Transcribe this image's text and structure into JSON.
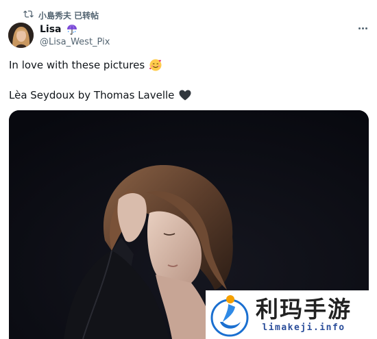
{
  "retweet": {
    "label": "小島秀夫 已转帖",
    "icon": "retweet-icon"
  },
  "author": {
    "display_name": "Lisa",
    "name_emoji": "umbrella-icon",
    "handle": "@Lisa_West_Pix",
    "avatar": "avatar"
  },
  "more_icon": "more-options-icon",
  "tweet": {
    "line1": "In love with these pictures",
    "line1_emoji": "smiling-face-with-hearts-icon",
    "line2": "Lèa Seydoux by Thomas Lavelle",
    "line2_emoji": "black-heart-icon"
  },
  "media": {
    "alt": "Black and white portrait photograph"
  },
  "watermark": {
    "brand": "利玛手游",
    "url": "limakeji.info",
    "colors": {
      "blue": "#1a6fd0",
      "orange": "#f5a000",
      "url": "#2a4d9a"
    }
  },
  "colors": {
    "text": "#0f1419",
    "secondary": "#536471",
    "photo_bg": "#0b0c14"
  }
}
